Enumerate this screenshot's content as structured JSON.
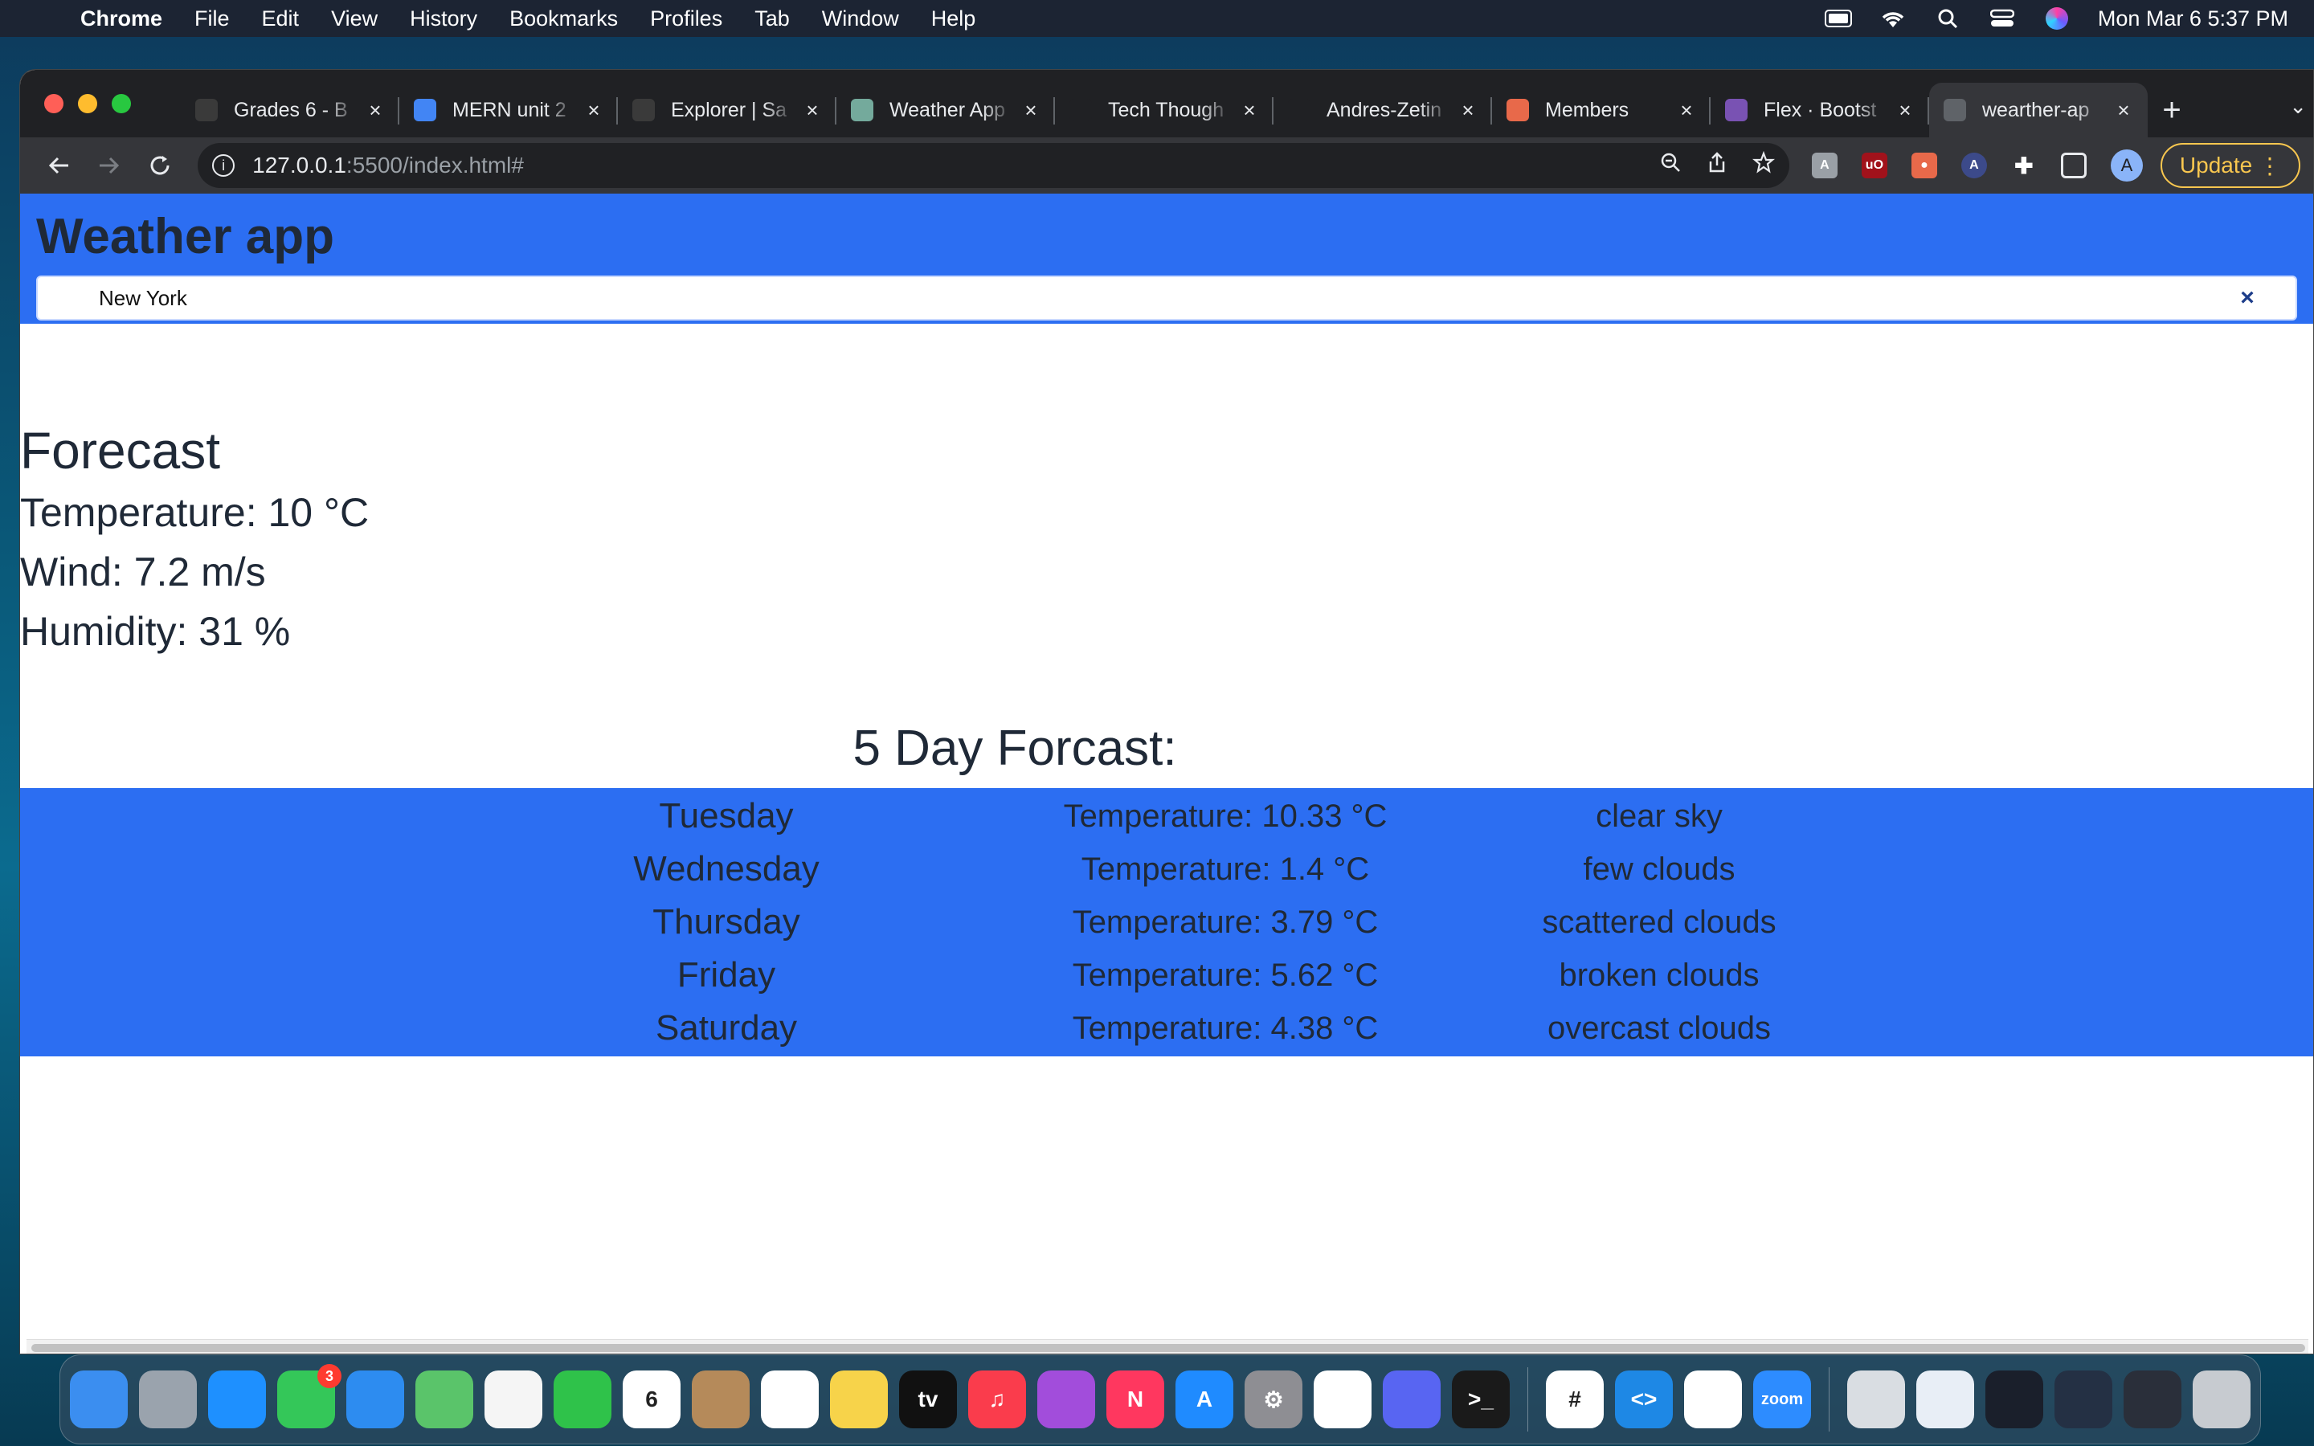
{
  "menubar": {
    "app_name": "Chrome",
    "items": [
      "File",
      "Edit",
      "View",
      "History",
      "Bookmarks",
      "Profiles",
      "Tab",
      "Window",
      "Help"
    ],
    "clock": "Mon Mar 6  5:37 PM"
  },
  "browser": {
    "tabs": [
      {
        "title": "Grades 6 - B",
        "icon": "grades-icon",
        "color": "#3a3a3a"
      },
      {
        "title": "MERN unit 2",
        "icon": "docs-icon",
        "color": "#4285f4"
      },
      {
        "title": "Explorer | Sa",
        "icon": "explorer-icon",
        "color": "#3a3a3a"
      },
      {
        "title": "Weather App",
        "icon": "openai-icon",
        "color": "#74aa9c"
      },
      {
        "title": "Tech Though",
        "icon": "react-icon",
        "color": "#202124"
      },
      {
        "title": "Andres-Zetin",
        "icon": "github-icon",
        "color": "#202124"
      },
      {
        "title": "Members",
        "icon": "members-icon",
        "color": "#e8694a"
      },
      {
        "title": "Flex · Bootst",
        "icon": "bootstrap-icon",
        "color": "#7952b3"
      },
      {
        "title": "wearther-ap",
        "icon": "globe-icon",
        "color": "#5f6368"
      }
    ],
    "active_tab_index": 8,
    "url_host": "127.0.0.1",
    "url_path": ":5500/index.html#",
    "update_label": "Update",
    "avatar_letter": "A"
  },
  "app": {
    "title": "Weather app",
    "search_value": "New York",
    "clear_label": "×",
    "forecast": {
      "heading": "Forecast",
      "temperature": "Temperature: 10 °C",
      "wind": "Wind: 7.2 m/s",
      "humidity": "Humidity: 31 %"
    },
    "five_day": {
      "heading": "5 Day Forcast:",
      "days": [
        {
          "day": "Tuesday",
          "temp": "Temperature: 10.33 °C",
          "desc": "clear sky"
        },
        {
          "day": "Wednesday",
          "temp": "Temperature: 1.4 °C",
          "desc": "few clouds"
        },
        {
          "day": "Thursday",
          "temp": "Temperature: 3.79 °C",
          "desc": "scattered clouds"
        },
        {
          "day": "Friday",
          "temp": "Temperature: 5.62 °C",
          "desc": "broken clouds"
        },
        {
          "day": "Saturday",
          "temp": "Temperature: 4.38 °C",
          "desc": "overcast clouds"
        }
      ]
    },
    "accent_color": "#2c6ef2"
  },
  "dock": {
    "apps": [
      {
        "name": "finder-icon",
        "color": "#3b8ef0",
        "glyph": ""
      },
      {
        "name": "launchpad-icon",
        "color": "#9aa3ad",
        "glyph": ""
      },
      {
        "name": "safari-icon",
        "color": "#1e90ff",
        "glyph": ""
      },
      {
        "name": "messages-icon",
        "color": "#34c759",
        "glyph": "",
        "badge": "3"
      },
      {
        "name": "mail-icon",
        "color": "#2d8cf0",
        "glyph": ""
      },
      {
        "name": "maps-icon",
        "color": "#5ac46a",
        "glyph": ""
      },
      {
        "name": "photos-icon",
        "color": "#f5f5f5",
        "glyph": ""
      },
      {
        "name": "facetime-icon",
        "color": "#2fc24a",
        "glyph": ""
      },
      {
        "name": "calendar-icon",
        "color": "#ffffff",
        "glyph": "6"
      },
      {
        "name": "contacts-icon",
        "color": "#b58a5a",
        "glyph": ""
      },
      {
        "name": "reminders-icon",
        "color": "#ffffff",
        "glyph": ""
      },
      {
        "name": "notes-icon",
        "color": "#f7d34a",
        "glyph": ""
      },
      {
        "name": "appletv-icon",
        "color": "#111111",
        "glyph": "tv"
      },
      {
        "name": "music-icon",
        "color": "#fa3c4c",
        "glyph": "♫"
      },
      {
        "name": "podcasts-icon",
        "color": "#a24ddb",
        "glyph": ""
      },
      {
        "name": "news-icon",
        "color": "#ff375f",
        "glyph": "N"
      },
      {
        "name": "appstore-icon",
        "color": "#1f8bff",
        "glyph": "A"
      },
      {
        "name": "system-settings-icon",
        "color": "#8e8e93",
        "glyph": "⚙"
      },
      {
        "name": "chrome-icon",
        "color": "#ffffff",
        "glyph": ""
      },
      {
        "name": "discord-icon",
        "color": "#5865f2",
        "glyph": ""
      },
      {
        "name": "terminal-icon",
        "color": "#1a1a1a",
        "glyph": ">_"
      },
      {
        "name": "slack-icon",
        "color": "#ffffff",
        "glyph": "#"
      },
      {
        "name": "vscode-icon",
        "color": "#1e88e5",
        "glyph": "<>"
      },
      {
        "name": "mongodb-icon",
        "color": "#ffffff",
        "glyph": ""
      },
      {
        "name": "zoom-icon",
        "color": "#2d8cff",
        "glyph": "zoom"
      },
      {
        "name": "downloads-icon",
        "color": "#d9dde2",
        "glyph": ""
      },
      {
        "name": "window-thumb-icon",
        "color": "#e8eef6",
        "glyph": ""
      },
      {
        "name": "window-thumb-icon",
        "color": "#1a1f2b",
        "glyph": ""
      },
      {
        "name": "window-thumb-icon",
        "color": "#243044",
        "glyph": ""
      },
      {
        "name": "window-thumb-icon",
        "color": "#2a2f3a",
        "glyph": ""
      },
      {
        "name": "trash-icon",
        "color": "#c7cbd0",
        "glyph": ""
      }
    ]
  }
}
